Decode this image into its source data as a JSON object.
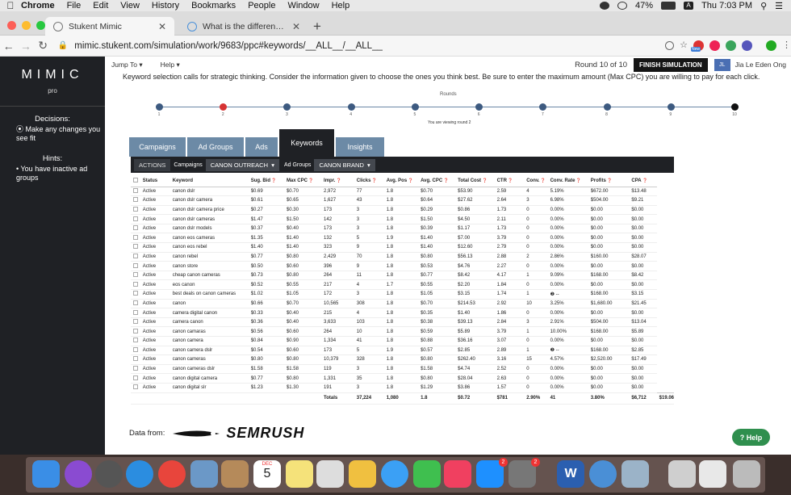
{
  "menubar": {
    "items": [
      "Chrome",
      "File",
      "Edit",
      "View",
      "History",
      "Bookmarks",
      "People",
      "Window",
      "Help"
    ],
    "battery": "47%",
    "clock": "Thu 7:03 PM",
    "input_letter": "A"
  },
  "browser": {
    "tabs": [
      {
        "label": "Stukent Mimic",
        "active": true
      },
      {
        "label": "What is the difference between",
        "active": false
      }
    ],
    "url": "mimic.stukent.com/simulation/work/9683/ppc#keywords/__ALL__/__ALL__",
    "ext_badge": "New"
  },
  "sidebar": {
    "logo": "MIMIC",
    "logo_sub": "pro",
    "decisions_title": "Decisions:",
    "decisions_items": [
      "Make any changes you see fit"
    ],
    "hints_title": "Hints:",
    "hints_items": [
      "You have inactive ad groups"
    ]
  },
  "header": {
    "jump_to": "Jump To",
    "help": "Help",
    "round": "Round 10 of 10",
    "finish": "FINISH SIMULATION",
    "avatar": "JL",
    "user": "Jia Le Eden Ong"
  },
  "instruction": "Keyword selection calls for strategic thinking. Consider the information given to choose the ones you think best. Be sure to enter the maximum amount (Max CPC) you are willing to pay for each click.",
  "timeline": {
    "title": "Rounds",
    "numbers": [
      "1",
      "2",
      "3",
      "4",
      "5",
      "6",
      "7",
      "8",
      "9",
      "10"
    ],
    "viewing": "You are viewing round 2",
    "colors": {
      "active": "#d63333",
      "current": "#111111",
      "default": "#3d5a80"
    }
  },
  "tabs": [
    "Campaigns",
    "Ad Groups",
    "Ads",
    "Keywords",
    "Insights"
  ],
  "toolbar": {
    "actions": "ACTIONS",
    "campaigns_label": "Campaigns",
    "campaign_value": "CANON OUTREACH",
    "adgroups_label": "Ad Groups",
    "adgroup_value": "CANON BRAND"
  },
  "table": {
    "headers": [
      "Status",
      "Keyword",
      "Sug. Bid",
      "Max CPC",
      "Impr.",
      "Clicks",
      "Avg. Pos",
      "Avg. CPC",
      "Total Cost",
      "CTR",
      "Conv.",
      "Conv. Rate",
      "Profits",
      "CPA"
    ],
    "rows": [
      [
        "Active",
        "canon dslr",
        "$0.69",
        "$0.70",
        "2,972",
        "77",
        "1.8",
        "$0.70",
        "$53.90",
        "2.59",
        "4",
        "5.19%",
        "$672.00",
        "$13.48"
      ],
      [
        "Active",
        "canon dslr camera",
        "$0.61",
        "$0.65",
        "1,627",
        "43",
        "1.8",
        "$0.64",
        "$27.62",
        "2.64",
        "3",
        "6.98%",
        "$504.00",
        "$9.21"
      ],
      [
        "Active",
        "canon dslr camera price",
        "$0.27",
        "$0.30",
        "173",
        "3",
        "1.8",
        "$0.29",
        "$0.86",
        "1.73",
        "0",
        "0.00%",
        "$0.00",
        "$0.00"
      ],
      [
        "Active",
        "canon dslr cameras",
        "$1.47",
        "$1.50",
        "142",
        "3",
        "1.8",
        "$1.50",
        "$4.50",
        "2.11",
        "0",
        "0.00%",
        "$0.00",
        "$0.00"
      ],
      [
        "Active",
        "canon dslr models",
        "$0.37",
        "$0.40",
        "173",
        "3",
        "1.8",
        "$0.39",
        "$1.17",
        "1.73",
        "0",
        "0.00%",
        "$0.00",
        "$0.00"
      ],
      [
        "Active",
        "canon eos cameras",
        "$1.35",
        "$1.40",
        "132",
        "5",
        "1.9",
        "$1.40",
        "$7.00",
        "3.79",
        "0",
        "0.00%",
        "$0.00",
        "$0.00"
      ],
      [
        "Active",
        "canon eos rebel",
        "$1.40",
        "$1.40",
        "323",
        "9",
        "1.8",
        "$1.40",
        "$12.60",
        "2.79",
        "0",
        "0.00%",
        "$0.00",
        "$0.00"
      ],
      [
        "Active",
        "canon rebel",
        "$0.77",
        "$0.80",
        "2,429",
        "70",
        "1.8",
        "$0.80",
        "$56.13",
        "2.88",
        "2",
        "2.86%",
        "$160.00",
        "$28.07"
      ],
      [
        "Active",
        "canon store",
        "$0.50",
        "$0.60",
        "396",
        "9",
        "1.8",
        "$0.53",
        "$4.76",
        "2.27",
        "0",
        "0.00%",
        "$0.00",
        "$0.00"
      ],
      [
        "Active",
        "cheap canon cameras",
        "$0.73",
        "$0.80",
        "264",
        "11",
        "1.8",
        "$0.77",
        "$8.42",
        "4.17",
        "1",
        "9.09%",
        "$168.00",
        "$8.42"
      ],
      [
        "Active",
        "eos canon",
        "$0.52",
        "$0.55",
        "217",
        "4",
        "1.7",
        "$0.55",
        "$2.20",
        "1.84",
        "0",
        "0.00%",
        "$0.00",
        "$0.00"
      ],
      [
        "Active",
        "best deals on canon cameras",
        "$1.02",
        "$1.05",
        "172",
        "3",
        "1.8",
        "$1.05",
        "$3.15",
        "1.74",
        "1",
        "❷ --",
        "$168.00",
        "$3.15"
      ],
      [
        "Active",
        "canon",
        "$0.66",
        "$0.70",
        "10,565",
        "308",
        "1.8",
        "$0.70",
        "$214.53",
        "2.92",
        "10",
        "3.25%",
        "$1,680.00",
        "$21.45"
      ],
      [
        "Active",
        "camera digital canon",
        "$0.33",
        "$0.40",
        "215",
        "4",
        "1.8",
        "$0.35",
        "$1.40",
        "1.86",
        "0",
        "0.00%",
        "$0.00",
        "$0.00"
      ],
      [
        "Active",
        "camera canon",
        "$0.36",
        "$0.40",
        "3,633",
        "103",
        "1.8",
        "$0.38",
        "$39.13",
        "2.84",
        "3",
        "2.91%",
        "$504.00",
        "$13.04"
      ],
      [
        "Active",
        "canon camaras",
        "$0.56",
        "$0.60",
        "264",
        "10",
        "1.8",
        "$0.59",
        "$5.89",
        "3.79",
        "1",
        "10.00%",
        "$168.00",
        "$5.89"
      ],
      [
        "Active",
        "canon camera",
        "$0.84",
        "$0.90",
        "1,334",
        "41",
        "1.8",
        "$0.88",
        "$36.16",
        "3.07",
        "0",
        "0.00%",
        "$0.00",
        "$0.00"
      ],
      [
        "Active",
        "canon camera dslr",
        "$0.54",
        "$0.60",
        "173",
        "5",
        "1.9",
        "$0.57",
        "$2.85",
        "2.89",
        "1",
        "❷ --",
        "$168.00",
        "$2.85"
      ],
      [
        "Active",
        "canon cameras",
        "$0.80",
        "$0.80",
        "10,379",
        "328",
        "1.8",
        "$0.80",
        "$262.40",
        "3.16",
        "15",
        "4.57%",
        "$2,520.00",
        "$17.49"
      ],
      [
        "Active",
        "canon cameras dslr",
        "$1.58",
        "$1.58",
        "119",
        "3",
        "1.8",
        "$1.58",
        "$4.74",
        "2.52",
        "0",
        "0.00%",
        "$0.00",
        "$0.00"
      ],
      [
        "Active",
        "canon digital camera",
        "$0.77",
        "$0.80",
        "1,331",
        "35",
        "1.8",
        "$0.80",
        "$28.04",
        "2.63",
        "0",
        "0.00%",
        "$0.00",
        "$0.00"
      ],
      [
        "Active",
        "canon digital slr",
        "$1.23",
        "$1.30",
        "191",
        "3",
        "1.8",
        "$1.29",
        "$3.86",
        "1.57",
        "0",
        "0.00%",
        "$0.00",
        "$0.00"
      ]
    ],
    "totals": {
      "label": "Totals",
      "impr": "37,224",
      "clicks": "1,080",
      "avg_pos": "1.8",
      "avg_cpc": "$0.72",
      "cost": "$781",
      "ctr": "2.90%",
      "conv": "41",
      "conv_rate": "3.80%",
      "profits": "$6,712",
      "cpa": "$19.06"
    }
  },
  "footer": {
    "data_from": "Data from:",
    "brand": "SEMRUSH",
    "help_button": "Help"
  },
  "dock": {
    "badges": [
      "2",
      "2"
    ],
    "calendar_month": "DEC",
    "calendar_day": "5"
  }
}
